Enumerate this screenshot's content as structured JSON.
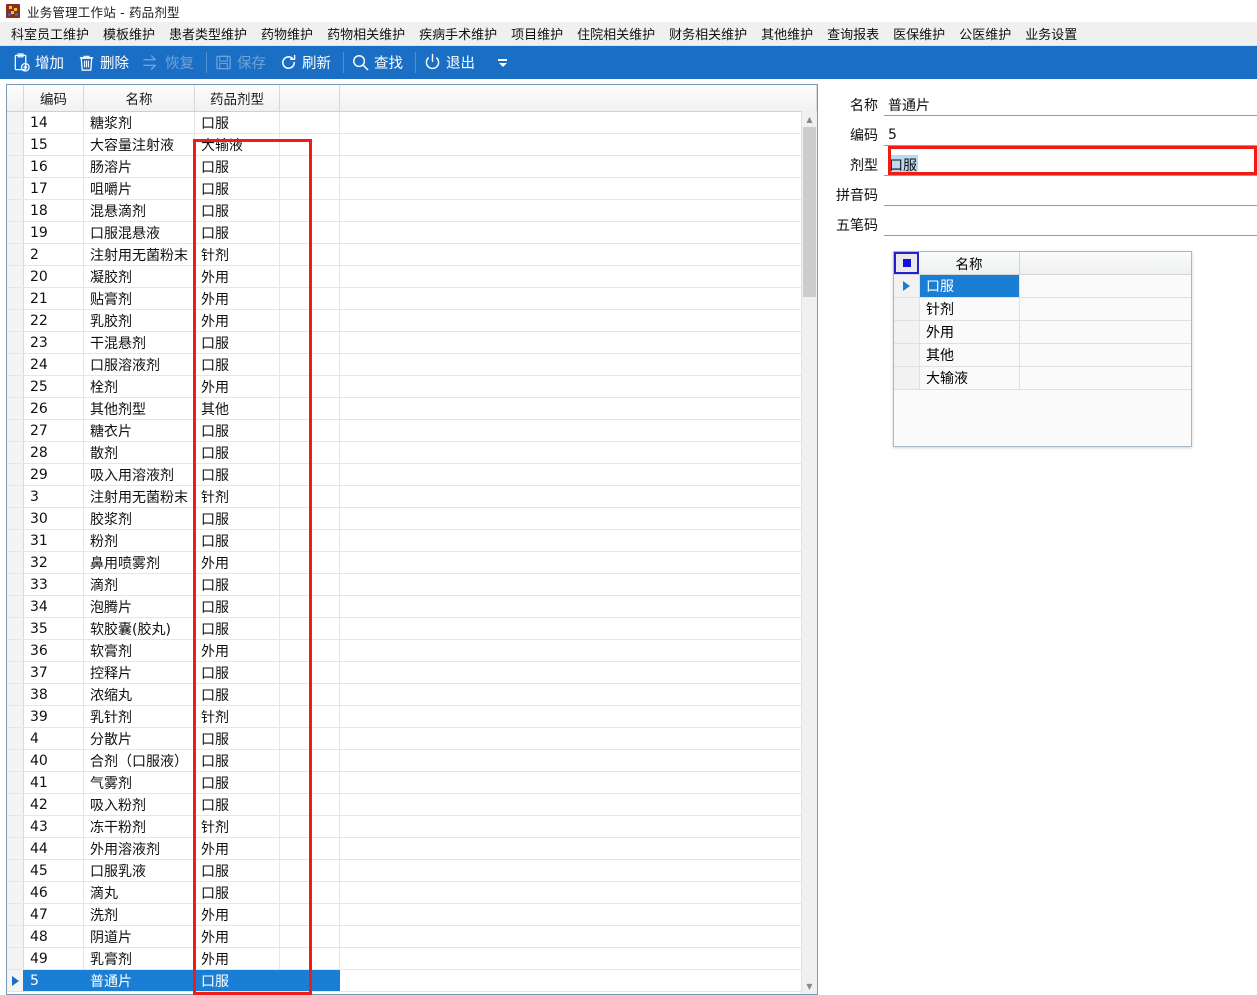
{
  "window": {
    "title": "业务管理工作站 - 药品剂型",
    "icon": "app-icon"
  },
  "menubar": {
    "items": [
      {
        "label": "科室员工维护"
      },
      {
        "label": "模板维护"
      },
      {
        "label": "患者类型维护"
      },
      {
        "label": "药物维护"
      },
      {
        "label": "药物相关维护"
      },
      {
        "label": "疾病手术维护"
      },
      {
        "label": "项目维护"
      },
      {
        "label": "住院相关维护"
      },
      {
        "label": "财务相关维护"
      },
      {
        "label": "其他维护"
      },
      {
        "label": "查询报表"
      },
      {
        "label": "医保维护"
      },
      {
        "label": "公医维护"
      },
      {
        "label": "业务设置"
      }
    ]
  },
  "toolbar": {
    "buttons": [
      {
        "label": "增加",
        "icon": "add-clipboard-icon",
        "disabled": false
      },
      {
        "label": "删除",
        "icon": "trash-icon",
        "disabled": false
      },
      {
        "label": "恢复",
        "icon": "undo-arrow-icon",
        "disabled": true
      },
      {
        "label": "保存",
        "icon": "save-disk-icon",
        "disabled": true
      },
      {
        "label": "刷新",
        "icon": "refresh-icon",
        "disabled": false
      },
      {
        "label": "查找",
        "icon": "search-icon",
        "disabled": false
      },
      {
        "label": "退出",
        "icon": "power-icon",
        "disabled": false
      }
    ],
    "overflow_icon": "toolbar-overflow-icon"
  },
  "grid": {
    "columns": [
      "编码",
      "名称",
      "药品剂型"
    ],
    "rows": [
      {
        "code": "14",
        "name": "糖浆剂",
        "form": "口服",
        "selected": false
      },
      {
        "code": "15",
        "name": "大容量注射液",
        "form": "大输液",
        "selected": false
      },
      {
        "code": "16",
        "name": "肠溶片",
        "form": "口服",
        "selected": false
      },
      {
        "code": "17",
        "name": "咀嚼片",
        "form": "口服",
        "selected": false
      },
      {
        "code": "18",
        "name": "混悬滴剂",
        "form": "口服",
        "selected": false
      },
      {
        "code": "19",
        "name": "口服混悬液",
        "form": "口服",
        "selected": false
      },
      {
        "code": "2",
        "name": "注射用无菌粉末（粉针剂）",
        "form": "针剂",
        "selected": false
      },
      {
        "code": "20",
        "name": "凝胶剂",
        "form": "外用",
        "selected": false
      },
      {
        "code": "21",
        "name": "贴膏剂",
        "form": "外用",
        "selected": false
      },
      {
        "code": "22",
        "name": "乳胶剂",
        "form": "外用",
        "selected": false
      },
      {
        "code": "23",
        "name": "干混悬剂",
        "form": "口服",
        "selected": false
      },
      {
        "code": "24",
        "name": "口服溶液剂",
        "form": "口服",
        "selected": false
      },
      {
        "code": "25",
        "name": "栓剂",
        "form": "外用",
        "selected": false
      },
      {
        "code": "26",
        "name": "其他剂型",
        "form": "其他",
        "selected": false
      },
      {
        "code": "27",
        "name": "糖衣片",
        "form": "口服",
        "selected": false
      },
      {
        "code": "28",
        "name": "散剂",
        "form": "口服",
        "selected": false
      },
      {
        "code": "29",
        "name": "吸入用溶液剂",
        "form": "口服",
        "selected": false
      },
      {
        "code": "3",
        "name": "注射用无菌粉末（溶媒结晶）",
        "form": "针剂",
        "selected": false
      },
      {
        "code": "30",
        "name": "胶浆剂",
        "form": "口服",
        "selected": false
      },
      {
        "code": "31",
        "name": "粉剂",
        "form": "口服",
        "selected": false
      },
      {
        "code": "32",
        "name": "鼻用喷雾剂",
        "form": "外用",
        "selected": false
      },
      {
        "code": "33",
        "name": "滴剂",
        "form": "口服",
        "selected": false
      },
      {
        "code": "34",
        "name": "泡腾片",
        "form": "口服",
        "selected": false
      },
      {
        "code": "35",
        "name": "软胶囊(胶丸)",
        "form": "口服",
        "selected": false
      },
      {
        "code": "36",
        "name": "软膏剂",
        "form": "外用",
        "selected": false
      },
      {
        "code": "37",
        "name": "控释片",
        "form": "口服",
        "selected": false
      },
      {
        "code": "38",
        "name": "浓缩丸",
        "form": "口服",
        "selected": false
      },
      {
        "code": "39",
        "name": "乳针剂",
        "form": "针剂",
        "selected": false
      },
      {
        "code": "4",
        "name": "分散片",
        "form": "口服",
        "selected": false
      },
      {
        "code": "40",
        "name": "合剂（口服液）",
        "form": "口服",
        "selected": false
      },
      {
        "code": "41",
        "name": "气雾剂",
        "form": "口服",
        "selected": false
      },
      {
        "code": "42",
        "name": "吸入粉剂",
        "form": "口服",
        "selected": false
      },
      {
        "code": "43",
        "name": "冻干粉剂",
        "form": "针剂",
        "selected": false
      },
      {
        "code": "44",
        "name": "外用溶液剂",
        "form": "外用",
        "selected": false
      },
      {
        "code": "45",
        "name": "口服乳液",
        "form": "口服",
        "selected": false
      },
      {
        "code": "46",
        "name": "滴丸",
        "form": "口服",
        "selected": false
      },
      {
        "code": "47",
        "name": "洗剂",
        "form": "外用",
        "selected": false
      },
      {
        "code": "48",
        "name": "阴道片",
        "form": "外用",
        "selected": false
      },
      {
        "code": "49",
        "name": "乳膏剂",
        "form": "外用",
        "selected": false
      },
      {
        "code": "5",
        "name": "普通片",
        "form": "口服",
        "selected": true
      }
    ]
  },
  "form": {
    "fields": [
      {
        "label": "名称",
        "value": "普通片",
        "highlighted": false,
        "selected_text": false
      },
      {
        "label": "编码",
        "value": "5",
        "highlighted": false,
        "selected_text": false
      },
      {
        "label": "剂型",
        "value": "口服",
        "highlighted": true,
        "selected_text": true
      },
      {
        "label": "拼音码",
        "value": "",
        "highlighted": false,
        "selected_text": false
      },
      {
        "label": "五笔码",
        "value": "",
        "highlighted": false,
        "selected_text": false
      }
    ]
  },
  "dropdown": {
    "header": {
      "name_col": "名称",
      "select_all_icon": "select-all-box-icon"
    },
    "items": [
      {
        "label": "口服",
        "selected": true
      },
      {
        "label": "针剂",
        "selected": false
      },
      {
        "label": "外用",
        "selected": false
      },
      {
        "label": "其他",
        "selected": false
      },
      {
        "label": "大输液",
        "selected": false
      }
    ]
  },
  "colors": {
    "toolbar_blue": "#1a6fc4",
    "selection_blue": "#1a7fd4",
    "highlight_red": "#ee1c15",
    "text_select_blue": "#bcd9f2"
  }
}
